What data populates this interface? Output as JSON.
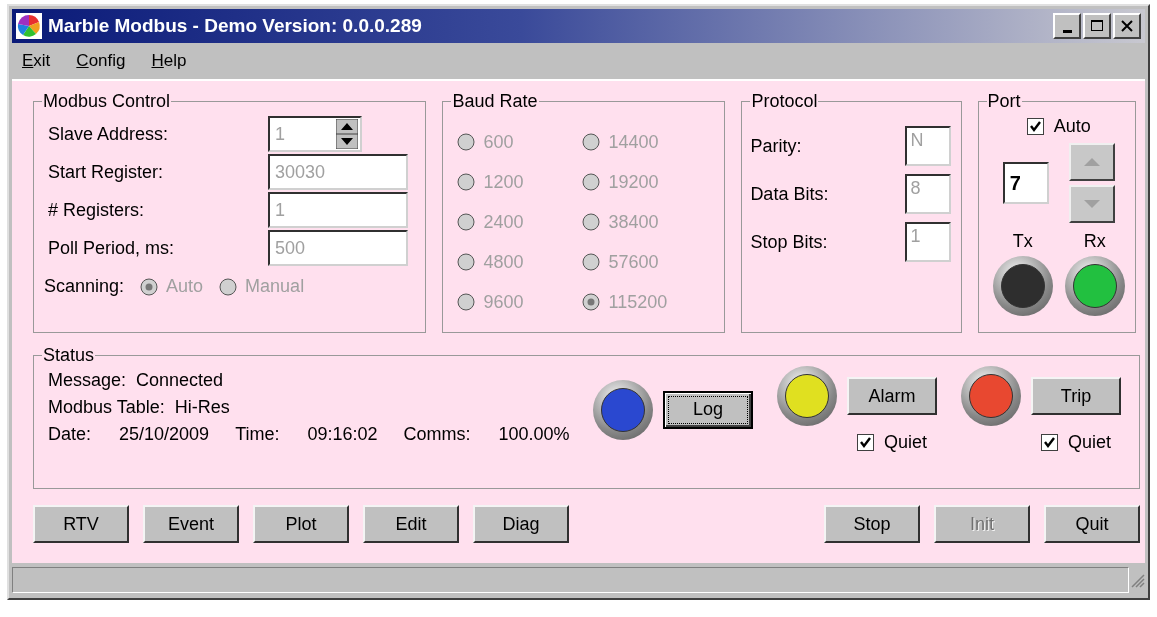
{
  "window": {
    "title": "Marble Modbus - Demo Version: 0.0.0.289"
  },
  "menu": [
    "Exit",
    "Config",
    "Help"
  ],
  "modbus_control": {
    "title": "Modbus Control",
    "fields": [
      {
        "label": "Slave Address:",
        "value": "1",
        "kind": "spin"
      },
      {
        "label": "Start Register:",
        "value": "30030",
        "kind": "text"
      },
      {
        "label": "# Registers:",
        "value": "1",
        "kind": "text"
      },
      {
        "label": "Poll Period, ms:",
        "value": "500",
        "kind": "text"
      }
    ],
    "scanning": {
      "label": "Scanning:",
      "options": [
        {
          "label": "Auto",
          "selected": true
        },
        {
          "label": "Manual",
          "selected": false
        }
      ]
    }
  },
  "baud_rate": {
    "title": "Baud Rate",
    "options": [
      {
        "label": "600",
        "selected": false
      },
      {
        "label": "1200",
        "selected": false
      },
      {
        "label": "2400",
        "selected": false
      },
      {
        "label": "4800",
        "selected": false
      },
      {
        "label": "9600",
        "selected": false
      },
      {
        "label": "14400",
        "selected": false
      },
      {
        "label": "19200",
        "selected": false
      },
      {
        "label": "38400",
        "selected": false
      },
      {
        "label": "57600",
        "selected": false
      },
      {
        "label": "115200",
        "selected": true
      }
    ]
  },
  "protocol": {
    "title": "Protocol",
    "fields": [
      {
        "label": "Parity:",
        "value": "N"
      },
      {
        "label": "Data Bits:",
        "value": "8"
      },
      {
        "label": "Stop Bits:",
        "value": "1"
      }
    ]
  },
  "port": {
    "title": "Port",
    "auto": {
      "label": "Auto",
      "checked": true
    },
    "value": "7",
    "indicators": [
      {
        "label": "Tx",
        "color": "#2e2e2e"
      },
      {
        "label": "Rx",
        "color": "#22c040"
      }
    ]
  },
  "status": {
    "title": "Status",
    "lines": [
      [
        {
          "label": "Message:",
          "value": "Connected"
        }
      ],
      [
        {
          "label": "Modbus Table:",
          "value": "Hi-Res"
        }
      ],
      [
        {
          "label": "Date:",
          "value": "25/10/2009"
        },
        {
          "label": "Time:",
          "value": "09:16:02"
        },
        {
          "label": "Comms:",
          "value": "100.00%"
        }
      ]
    ],
    "alarms": [
      {
        "color": "#2a48d0",
        "button": "Log",
        "focused": true
      },
      {
        "color": "#e0e020",
        "button": "Alarm",
        "focused": false,
        "quiet": {
          "label": "Quiet",
          "checked": true
        }
      },
      {
        "color": "#e84830",
        "button": "Trip",
        "focused": false,
        "quiet": {
          "label": "Quiet",
          "checked": true
        }
      }
    ]
  },
  "buttons_left": [
    {
      "label": "RTV",
      "disabled": false
    },
    {
      "label": "Event",
      "disabled": false
    },
    {
      "label": "Plot",
      "disabled": false
    },
    {
      "label": "Edit",
      "disabled": false
    },
    {
      "label": "Diag",
      "disabled": false
    }
  ],
  "buttons_right": [
    {
      "label": "Stop",
      "disabled": false
    },
    {
      "label": "Init",
      "disabled": true
    },
    {
      "label": "Quit",
      "disabled": false
    }
  ]
}
